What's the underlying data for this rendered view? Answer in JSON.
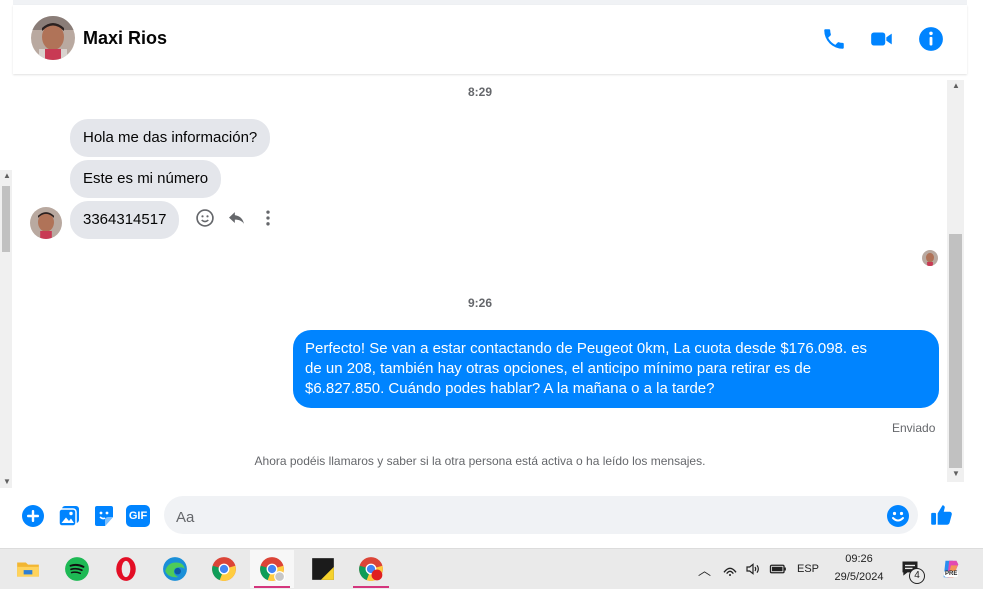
{
  "header": {
    "contact_name": "Maxi Rios",
    "icons": [
      "phone-icon",
      "video-camera-icon",
      "info-icon"
    ],
    "accent_color": "#0084ff"
  },
  "chat": {
    "time_1": "8:29",
    "incoming": [
      {
        "text": "Hola me das información?"
      },
      {
        "text": "Este es mi número"
      },
      {
        "text": "3364314517"
      }
    ],
    "time_2": "9:26",
    "outgoing": {
      "line1": "Perfecto!  Se van a estar contactando de Peugeot 0km, La cuota desde $176.098. es",
      "line2": "de un 208, también hay otras opciones, el anticipo mínimo para retirar es de",
      "line3": "$6.827.850. Cuándo podes hablar? A la mañana o a la tarde?"
    },
    "status": "Enviado",
    "system_note": "Ahora podéis llamaros y saber si la otra persona está activa o ha leído los mensajes."
  },
  "composer": {
    "placeholder": "Aa",
    "icons": [
      "add-icon",
      "image-icon",
      "sticker-icon",
      "gif-icon",
      "emoji-icon",
      "like-icon"
    ],
    "gif_label": "GIF"
  },
  "taskbar": {
    "apps": [
      "file-explorer",
      "spotify",
      "opera",
      "edge",
      "chrome",
      "chrome-profile",
      "sticky-notes",
      "chrome-alt"
    ],
    "language": "ESP",
    "time": "09:26",
    "date": "29/5/2024",
    "notification_count": "4",
    "copilot_badge": "PRE"
  }
}
